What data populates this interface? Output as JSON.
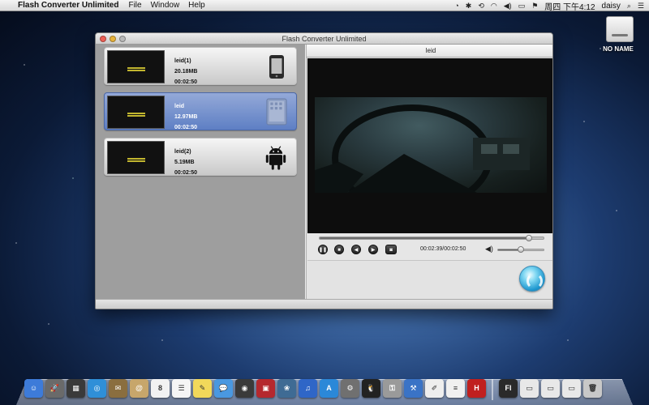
{
  "menubar": {
    "app_name": "Flash Converter Unlimited",
    "menus": [
      "File",
      "Window",
      "Help"
    ],
    "status": {
      "day_time": "周四 下午4:12",
      "user": "daisy"
    }
  },
  "desktop": {
    "drive_label": "NO NAME"
  },
  "window": {
    "title": "Flash Converter Unlimited",
    "items": [
      {
        "name": "leid(1)",
        "size": "20.18MB",
        "duration": "00:02:50",
        "device": "phone",
        "selected": false
      },
      {
        "name": "leid",
        "size": "12.97MB",
        "duration": "00:02:50",
        "device": "tablet",
        "selected": true
      },
      {
        "name": "leid(2)",
        "size": "5.19MB",
        "duration": "00:02:50",
        "device": "android",
        "selected": false
      }
    ],
    "preview": {
      "title": "leid",
      "time_display": "00:02:39/00:02:50",
      "progress_fraction": 0.935,
      "volume_fraction": 0.5
    }
  },
  "dock": {
    "icons": [
      {
        "name": "finder-icon",
        "color": "#3d7bd9",
        "glyph": "☺"
      },
      {
        "name": "launchpad-icon",
        "color": "#6a6a6a",
        "glyph": "🚀"
      },
      {
        "name": "mission-control-icon",
        "color": "#3a3a3a",
        "glyph": "▦"
      },
      {
        "name": "safari-icon",
        "color": "#2f8fd8",
        "glyph": "◎"
      },
      {
        "name": "mail-stamp-icon",
        "color": "#8a6e3f",
        "glyph": "✉"
      },
      {
        "name": "contacts-icon",
        "color": "#c7a66b",
        "glyph": "@"
      },
      {
        "name": "calendar-icon",
        "color": "#f2f2f2",
        "glyph": "8"
      },
      {
        "name": "reminders-icon",
        "color": "#f5f5f5",
        "glyph": "☰"
      },
      {
        "name": "notes-icon",
        "color": "#f2d85a",
        "glyph": "✎"
      },
      {
        "name": "messages-icon",
        "color": "#4a98e0",
        "glyph": "💬"
      },
      {
        "name": "facetime-icon",
        "color": "#3a3a3a",
        "glyph": "◉"
      },
      {
        "name": "photo-booth-icon",
        "color": "#b5282e",
        "glyph": "▣"
      },
      {
        "name": "iphoto-icon",
        "color": "#3f6b94",
        "glyph": "❀"
      },
      {
        "name": "itunes-icon",
        "color": "#2f66c7",
        "glyph": "♫"
      },
      {
        "name": "app-store-icon",
        "color": "#2b88d8",
        "glyph": "A"
      },
      {
        "name": "system-prefs-icon",
        "color": "#707070",
        "glyph": "⚙"
      },
      {
        "name": "qq-icon",
        "color": "#222222",
        "glyph": "🐧"
      },
      {
        "name": "keychain-icon",
        "color": "#9a9a9a",
        "glyph": "⚿"
      },
      {
        "name": "xcode-icon",
        "color": "#3a73c6",
        "glyph": "⚒"
      },
      {
        "name": "pages-icon",
        "color": "#eeeeee",
        "glyph": "✐"
      },
      {
        "name": "textedit-icon",
        "color": "#f0f0f0",
        "glyph": "≡"
      },
      {
        "name": "flash-converter-icon",
        "color": "#c0201f",
        "glyph": "H"
      }
    ],
    "right_icons": [
      {
        "name": "flash-icon",
        "color": "#2a2a2a",
        "glyph": "Fl"
      },
      {
        "name": "window-icon-1",
        "color": "#e8e8e8",
        "glyph": "▭"
      },
      {
        "name": "window-icon-2",
        "color": "#e8e8e8",
        "glyph": "▭"
      },
      {
        "name": "window-icon-3",
        "color": "#e8e8e8",
        "glyph": "▭"
      },
      {
        "name": "trash-icon",
        "color": "#c8c8c8",
        "glyph": "🗑"
      }
    ]
  }
}
